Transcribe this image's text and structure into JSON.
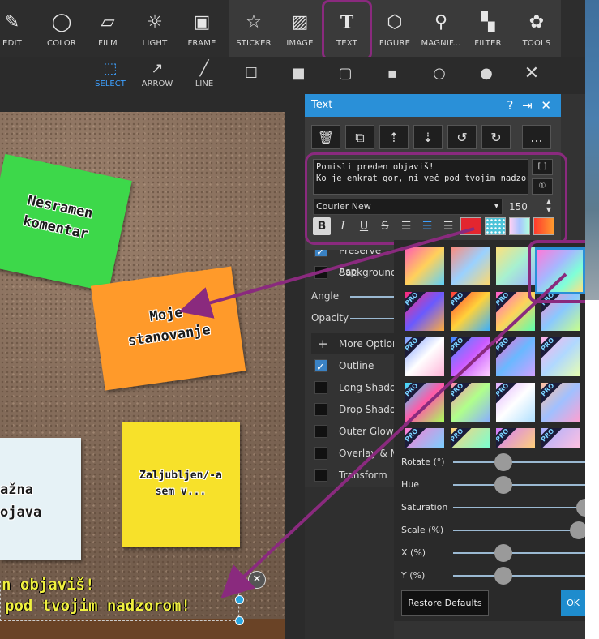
{
  "toolbar": {
    "edit": "EDIT",
    "color": "COLOR",
    "film": "FILM",
    "light": "LIGHT",
    "frame": "FRAME",
    "sticker": "STICKER",
    "image": "IMAGE",
    "text": "TEXT",
    "figure": "FIGURE",
    "magnifier": "MAGNIF...",
    "filter": "FILTER",
    "tools": "TOOLS"
  },
  "subbar": {
    "select": "SELECT",
    "arrow": "ARROW",
    "line": "LINE"
  },
  "notes": {
    "green": [
      "Nesramen",
      "komentar"
    ],
    "orange": [
      "Moje",
      "stanovanje"
    ],
    "yellow": [
      "Zaljubljen/-a",
      "sem v..."
    ],
    "white": [
      "ažna",
      "ojava"
    ]
  },
  "overlay_text": [
    "n objaviš!",
    "pod tvojim nadzorom!"
  ],
  "text_dialog": {
    "title": "Text",
    "text_value": "Pomisli preden objaviš!\nKo je enkrat gor, ni več pod tvojim nadzorom!",
    "font": "Courier New",
    "size": "150",
    "more_label": "...",
    "side_btn_1": "[ ]",
    "side_btn_2": "①"
  },
  "background_panel": {
    "preserve": "Preserve Asp",
    "background": "Background",
    "angle": "Angle",
    "opacity": "Opacity",
    "more_options": "More Option",
    "outline": "Outline",
    "long_shadow": "Long Shado",
    "drop_shadow": "Drop Shado",
    "outer_glow": "Outer Glow",
    "overlay": "Overlay & M",
    "transform": "Transform"
  },
  "gradient_picker": {
    "pro_label": "PRO",
    "sliders": [
      {
        "label": "Rotate (°)",
        "value": 0.38
      },
      {
        "label": "Hue",
        "value": 0.38
      },
      {
        "label": "Saturation",
        "value": 1.0
      },
      {
        "label": "Scale (%)",
        "value": 0.95
      },
      {
        "label": "X (%)",
        "value": 0.38
      },
      {
        "label": "Y (%)",
        "value": 0.38
      }
    ],
    "restore": "Restore Defaults",
    "ok": "OK"
  },
  "colors": {
    "accent": "#2a90d8",
    "highlight": "#8a2a7e",
    "overlay_text": "#f0f040"
  }
}
